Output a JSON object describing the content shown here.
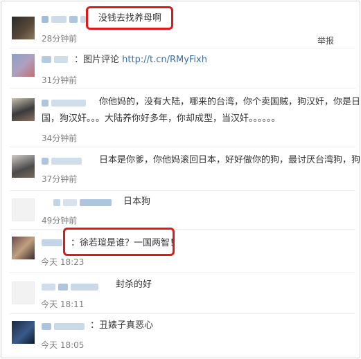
{
  "comments": [
    {
      "text": "没钱去找养母啊",
      "time": "28分钟前",
      "report": "举报"
    },
    {
      "text": "：图片评论 ",
      "link": "http://t.cn/RMyFixh",
      "time": "31分钟前"
    },
    {
      "text_line1": "你他妈的，没有大陆，哪来的台湾，你个卖国贼，狗汉奸，你是日本奸出",
      "text_line2": "国，狗汉奸。。。大陆养你好多年，你却成型，当汉奸。。。。。。",
      "time": "34分钟前"
    },
    {
      "text": "日本是你爹，你他妈滚回日本，好好做你的狗，最讨厌台湾狗，狗汉奸",
      "time": "37分钟前"
    },
    {
      "text": "日本狗",
      "time": "49分钟前"
    },
    {
      "text": "：徐若瑄是谁？一国两智！",
      "time": "今天 18:23"
    },
    {
      "text": "封杀的好",
      "time": "今天 18:11"
    },
    {
      "text": "：丑婊子真恶心",
      "time": "今天 18:05"
    }
  ],
  "colors": {
    "highlight": "#e01818",
    "link": "#3b6ea5",
    "meta": "#808080"
  }
}
